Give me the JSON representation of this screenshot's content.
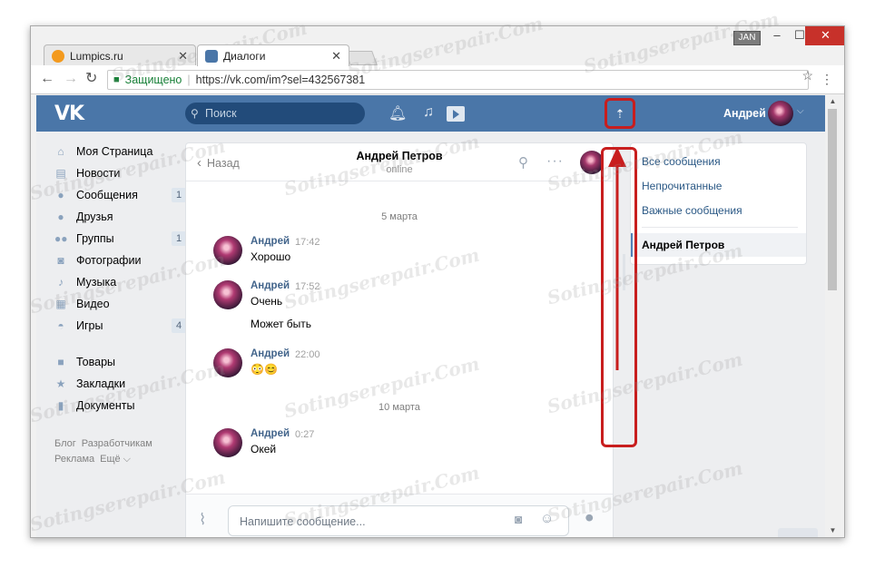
{
  "browser": {
    "tabs": [
      {
        "title": "Lumpics.ru",
        "icon": "lumpics-favicon",
        "active": false
      },
      {
        "title": "Диалоги",
        "icon": "vk-messages-favicon",
        "active": true
      }
    ],
    "user_badge": "JAN",
    "window_controls": {
      "minimize": "–",
      "maximize": "☐",
      "close": "✕"
    },
    "secure_label": "Защищено",
    "url": "https://vk.com/im?sel=432567381"
  },
  "vk": {
    "logo": "VK",
    "search_placeholder": "Поиск",
    "user_name": "Андрей",
    "brand_color": "#4a76a8",
    "left_nav": [
      {
        "label": "Моя Страница",
        "icon": "home-icon",
        "count": ""
      },
      {
        "label": "Новости",
        "icon": "news-icon",
        "count": ""
      },
      {
        "label": "Сообщения",
        "icon": "messages-icon",
        "count": "1"
      },
      {
        "label": "Друзья",
        "icon": "friends-icon",
        "count": ""
      },
      {
        "label": "Группы",
        "icon": "groups-icon",
        "count": "1"
      },
      {
        "label": "Фотографии",
        "icon": "camera-icon",
        "count": ""
      },
      {
        "label": "Музыка",
        "icon": "music-icon",
        "count": ""
      },
      {
        "label": "Видео",
        "icon": "video-icon",
        "count": ""
      },
      {
        "label": "Игры",
        "icon": "gamepad-icon",
        "count": "4"
      }
    ],
    "left_nav_secondary": [
      {
        "label": "Товары",
        "icon": "bag-icon"
      },
      {
        "label": "Закладки",
        "icon": "star-icon"
      },
      {
        "label": "Документы",
        "icon": "document-icon"
      }
    ],
    "footer_links": [
      "Блог",
      "Разработчикам",
      "Реклама",
      "Ещё ⌵"
    ],
    "chat": {
      "back_label": "Назад",
      "title": "Андрей Петров",
      "status": "online",
      "date_1": "5 марта",
      "date_2": "10 марта",
      "messages": [
        {
          "author": "Андрей",
          "time": "17:42",
          "text": "Хорошо",
          "extra": ""
        },
        {
          "author": "Андрей",
          "time": "17:52",
          "text": "Очень",
          "extra": "Может быть"
        },
        {
          "author": "Андрей",
          "time": "22:00",
          "text": "😳😊",
          "extra": ""
        },
        {
          "author": "Андрей",
          "time": "0:27",
          "text": "Окей",
          "extra": ""
        }
      ],
      "input_placeholder": "Напишите сообщение..."
    },
    "right_panel": {
      "items": [
        "Все сообщения",
        "Непрочитанные",
        "Важные сообщения"
      ],
      "selected": "Андрей Петров"
    },
    "people_count": "1"
  },
  "watermark": "Sotingserepair.Com",
  "annotation_color": "#c81e1e"
}
